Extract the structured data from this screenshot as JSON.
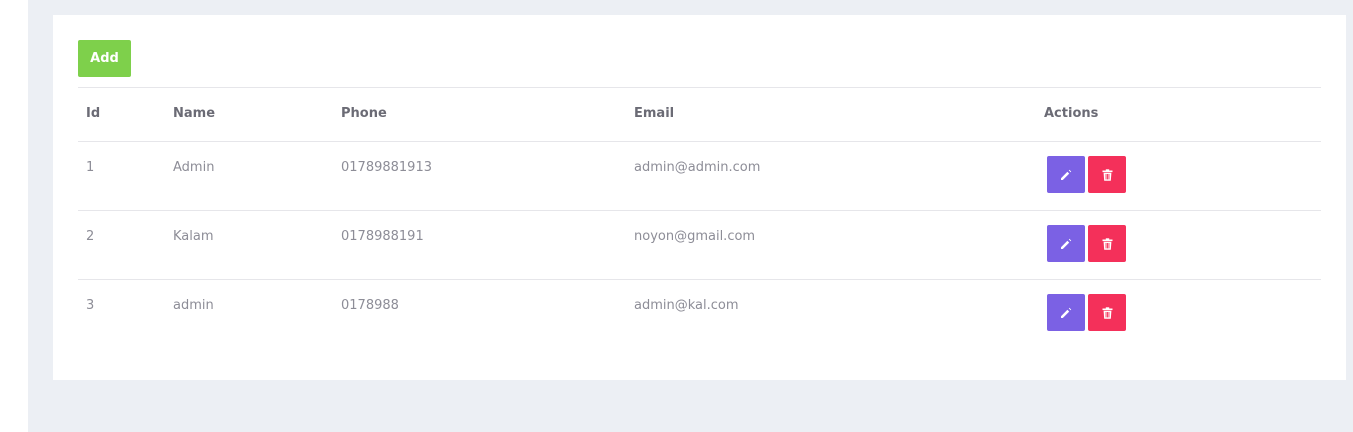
{
  "toolbar": {
    "add_label": "Add"
  },
  "table": {
    "headers": {
      "id": "Id",
      "name": "Name",
      "phone": "Phone",
      "email": "Email",
      "actions": "Actions"
    },
    "rows": [
      {
        "id": "1",
        "name": "Admin",
        "phone": "01789881913",
        "email": "admin@admin.com"
      },
      {
        "id": "2",
        "name": "Kalam",
        "phone": "0178988191",
        "email": "noyon@gmail.com"
      },
      {
        "id": "3",
        "name": "admin",
        "phone": "0178988",
        "email": "admin@kal.com"
      }
    ]
  },
  "icons": {
    "edit": "pencil-icon",
    "delete": "trash-icon"
  },
  "colors": {
    "add": "#7ed04b",
    "edit": "#7b61e4",
    "delete": "#f4305a",
    "background": "#eceff4"
  }
}
